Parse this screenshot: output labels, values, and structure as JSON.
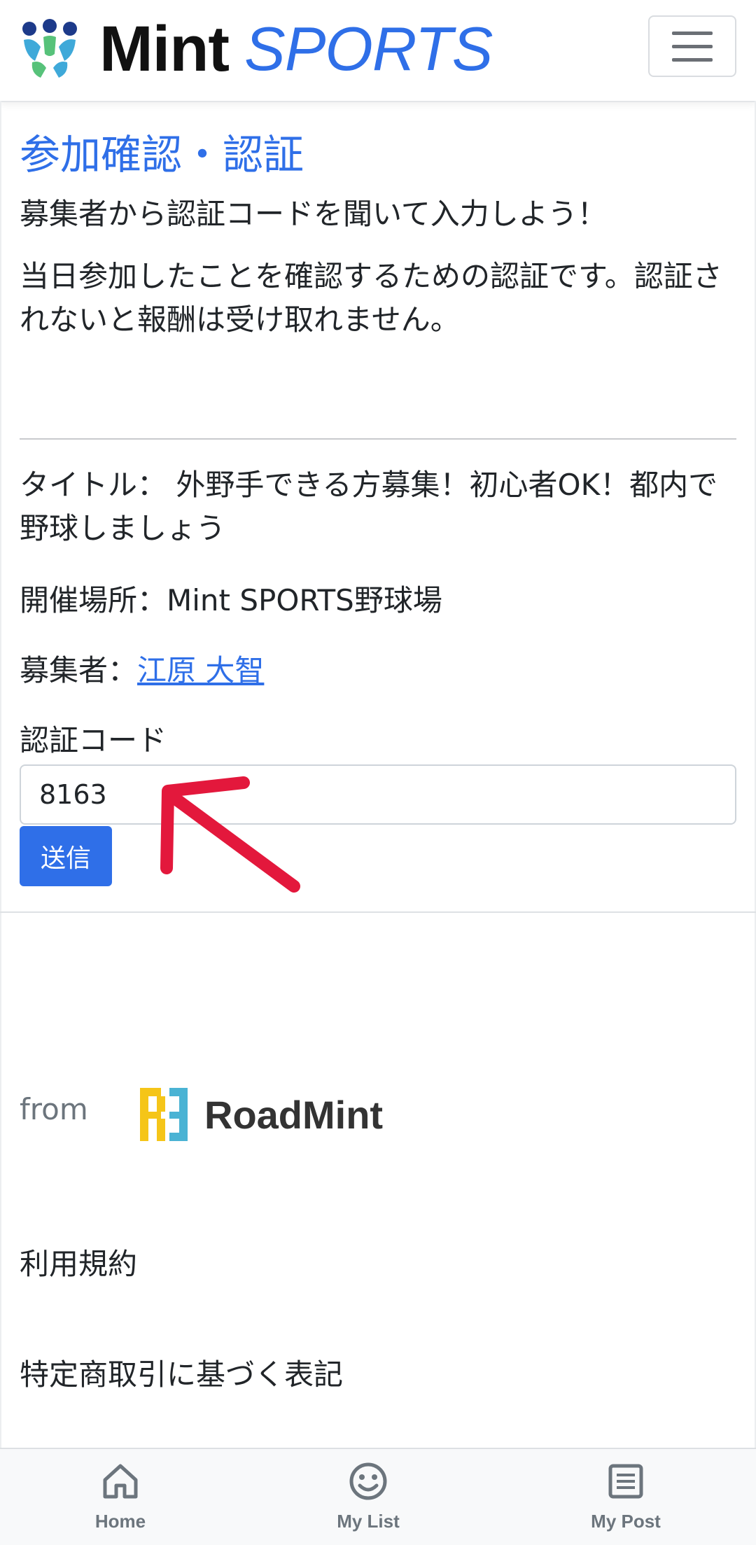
{
  "header": {
    "brand_mint": "Mint",
    "brand_sports": "SPORTS",
    "menu_icon": "hamburger-menu-icon"
  },
  "main": {
    "title": "参加確認・認証",
    "subtitle": "募集者から認証コードを聞いて入力しよう！",
    "description": "当日参加したことを確認するための認証です。認証されないと報酬は受け取れません。",
    "event_title": "タイトル： 外野手できる方募集！初心者OK！都内で野球しましょう",
    "venue": "開催場所：Mint SPORTS野球場",
    "organizer_label": "募集者：",
    "organizer_name": "江原 大智",
    "code_label": "認証コード",
    "code_value": "8163",
    "submit_label": "送信"
  },
  "footer": {
    "from_label": "from",
    "company_name": "RoadMint",
    "terms_link": "利用規約",
    "legal_link": "特定商取引に基づく表記"
  },
  "bottom_nav": {
    "items": [
      {
        "label": "Home",
        "icon": "home-icon"
      },
      {
        "label": "My List",
        "icon": "smiley-icon"
      },
      {
        "label": "My Post",
        "icon": "document-icon"
      }
    ]
  },
  "colors": {
    "accent": "#2f6fe8",
    "arrow": "#e3183c",
    "nav_background": "#f8f9fa",
    "muted_text": "#6c757d"
  }
}
